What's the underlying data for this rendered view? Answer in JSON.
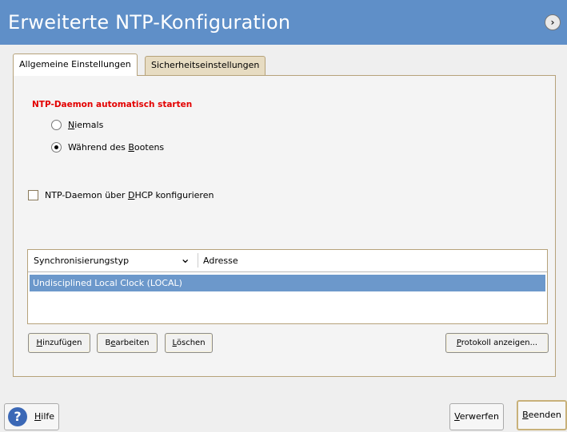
{
  "window": {
    "title": "Erweiterte NTP-Konfiguration",
    "corner_icon": "help-arrow-icon"
  },
  "tabs": [
    {
      "label": "Allgemeine Einstellungen",
      "active": true
    },
    {
      "label": "Sicherheitseinstellungen",
      "active": false
    }
  ],
  "start_section": {
    "title": "NTP-Daemon automatisch starten",
    "options": [
      {
        "label": "Niemals",
        "selected": false
      },
      {
        "label": "Während des Bootens",
        "selected": true
      }
    ]
  },
  "dhcp_checkbox": {
    "label": "NTP-Daemon über DHCP konfigurieren",
    "checked": false
  },
  "table": {
    "columns": [
      "Synchronisierungstyp",
      "Adresse"
    ],
    "rows": [
      {
        "type": "Undisciplined Local Clock (LOCAL)",
        "address": ""
      }
    ]
  },
  "actions": {
    "add": "Hinzufügen",
    "edit": "Bearbeiten",
    "delete": "Löschen",
    "log": "Protokoll anzeigen..."
  },
  "footer": {
    "help": "Hilfe",
    "discard": "Verwerfen",
    "finish": "Beenden"
  },
  "colors": {
    "title_bar": "#5f8fc8",
    "section_title": "#e30000",
    "selected_row": "#6c98cb"
  }
}
